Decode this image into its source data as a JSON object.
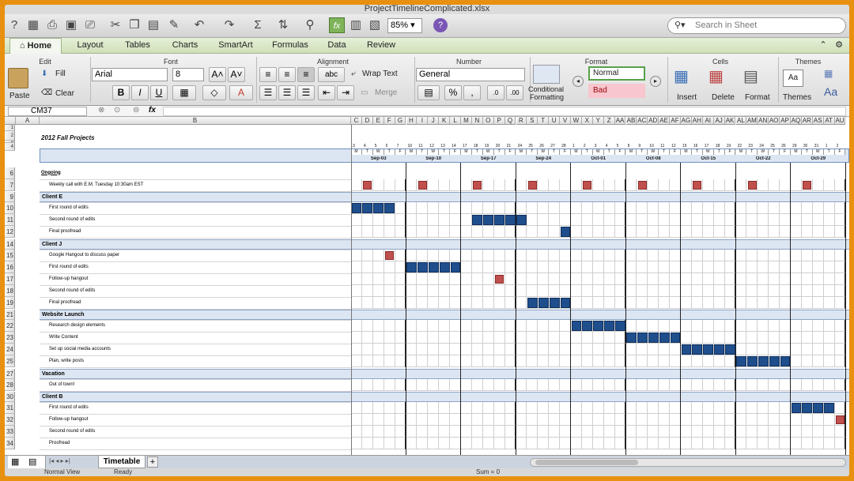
{
  "window": {
    "title": "ProjectTimelineComplicated.xlsx"
  },
  "toolbar": {
    "zoom": "85%",
    "search_placeholder": "Search in Sheet"
  },
  "ribbon": {
    "tabs": [
      "Home",
      "Layout",
      "Tables",
      "Charts",
      "SmartArt",
      "Formulas",
      "Data",
      "Review"
    ],
    "groups": {
      "edit": "Edit",
      "font": "Font",
      "alignment": "Alignment",
      "number": "Number",
      "format": "Format",
      "cells": "Cells",
      "themes": "Themes"
    },
    "paste": "Paste",
    "fill": "Fill",
    "clear": "Clear",
    "font_name": "Arial",
    "font_size": "8",
    "wrap_text": "Wrap Text",
    "merge": "Merge",
    "abc": "abc",
    "number_format": "General",
    "conditional_formatting_1": "Conditional",
    "conditional_formatting_2": "Formatting",
    "style_normal": "Normal",
    "style_bad": "Bad",
    "insert": "Insert",
    "delete": "Delete",
    "format": "Format",
    "themes": "Themes"
  },
  "formula_bar": {
    "cell_ref": "CM37",
    "fx": "fx"
  },
  "sheet": {
    "title": "2012 Fall Projects",
    "col_a": "A",
    "col_b": "B",
    "date_cols": [
      "C",
      "D",
      "E",
      "F",
      "G",
      "H",
      "I",
      "J",
      "K",
      "L",
      "M",
      "N",
      "O",
      "P",
      "Q",
      "R",
      "S",
      "T",
      "U",
      "V",
      "W",
      "X",
      "Y",
      "Z",
      "AA",
      "AB",
      "AC",
      "AD",
      "AE",
      "AF",
      "AG",
      "AH",
      "AI",
      "AJ",
      "AK",
      "AL",
      "AM",
      "AN",
      "AO",
      "AP",
      "AQ",
      "AR",
      "AS",
      "AT",
      "AU"
    ],
    "day_numbers": [
      "3",
      "4",
      "5",
      "6",
      "7",
      "10",
      "11",
      "12",
      "13",
      "14",
      "17",
      "18",
      "19",
      "20",
      "21",
      "24",
      "25",
      "26",
      "27",
      "28",
      "1",
      "2",
      "3",
      "4",
      "5",
      "8",
      "9",
      "10",
      "11",
      "12",
      "15",
      "16",
      "17",
      "18",
      "19",
      "22",
      "23",
      "24",
      "25",
      "26",
      "29",
      "30",
      "31",
      "1",
      "2"
    ],
    "weekdays": [
      "M",
      "T",
      "W",
      "T",
      "F"
    ],
    "weeks": [
      "Sep-03",
      "Sep-10",
      "Sep-17",
      "Sep-24",
      "Oct-01",
      "Oct-08",
      "Oct-15",
      "Oct-22",
      "Oct-29"
    ],
    "row_numbers": [
      "1",
      "2",
      "3",
      "4",
      "6",
      "7",
      "9",
      "10",
      "11",
      "12",
      "14",
      "15",
      "16",
      "17",
      "18",
      "19",
      "21",
      "22",
      "23",
      "24",
      "25",
      "27",
      "28",
      "30",
      "31",
      "32",
      "33",
      "34"
    ],
    "rows": [
      {
        "num": "6",
        "type": "heading",
        "label": "Ongoing"
      },
      {
        "num": "7",
        "type": "task",
        "label": "Weekly call with E.M. Tuesday 10:30am EST",
        "red": [
          1,
          6,
          11,
          16,
          21,
          26,
          31,
          36,
          41
        ]
      },
      {
        "num": "9",
        "type": "section",
        "label": "Client E"
      },
      {
        "num": "10",
        "type": "task",
        "label": "First round of edits",
        "blue": [
          0,
          1,
          2,
          3
        ]
      },
      {
        "num": "11",
        "type": "task",
        "label": "Second round of edits",
        "blue": [
          11,
          12,
          13,
          14,
          15
        ]
      },
      {
        "num": "12",
        "type": "task",
        "label": "Final proofread",
        "blue": [
          19
        ]
      },
      {
        "num": "14",
        "type": "section",
        "label": "Client J"
      },
      {
        "num": "15",
        "type": "task",
        "label": "Google Hangout to discuss paper",
        "red": [
          3
        ]
      },
      {
        "num": "16",
        "type": "task",
        "label": "First round of edits",
        "blue": [
          5,
          6,
          7,
          8,
          9
        ]
      },
      {
        "num": "17",
        "type": "task",
        "label": "Follow-up hangout",
        "red": [
          13
        ]
      },
      {
        "num": "18",
        "type": "task",
        "label": "Second round of edits"
      },
      {
        "num": "19",
        "type": "task",
        "label": "Final proofread",
        "blue": [
          16,
          17,
          18,
          19
        ]
      },
      {
        "num": "21",
        "type": "section",
        "label": "Website Launch"
      },
      {
        "num": "22",
        "type": "task",
        "label": "Research design elements",
        "blue": [
          20,
          21,
          22,
          23,
          24
        ]
      },
      {
        "num": "23",
        "type": "task",
        "label": "Write Content",
        "blue": [
          25,
          26,
          27,
          28,
          29
        ]
      },
      {
        "num": "24",
        "type": "task",
        "label": "Set up social media accounts",
        "blue": [
          30,
          31,
          32,
          33,
          34
        ]
      },
      {
        "num": "25",
        "type": "task",
        "label": "Plan, write  posts",
        "blue": [
          35,
          36,
          37,
          38,
          39
        ]
      },
      {
        "num": "27",
        "type": "section",
        "label": "Vacation"
      },
      {
        "num": "28",
        "type": "task",
        "label": "Out of town!"
      },
      {
        "num": "30",
        "type": "section",
        "label": "Client B"
      },
      {
        "num": "31",
        "type": "task",
        "label": "First round of edits",
        "blue": [
          40,
          41,
          42,
          43
        ]
      },
      {
        "num": "32",
        "type": "task",
        "label": "Follow-up hangout",
        "red": [
          44
        ]
      },
      {
        "num": "33",
        "type": "task",
        "label": "Second round of edits"
      },
      {
        "num": "34",
        "type": "task",
        "label": "Proofread"
      }
    ]
  },
  "sheet_tabs": {
    "active": "Timetable",
    "add": "+"
  },
  "status": {
    "view": "Normal View",
    "ready": "Ready",
    "sum": "Sum = 0"
  },
  "colors": {
    "blue_bar": "#1f4e8c",
    "red_marker": "#c0504d",
    "section_fill": "#dce6f2"
  }
}
